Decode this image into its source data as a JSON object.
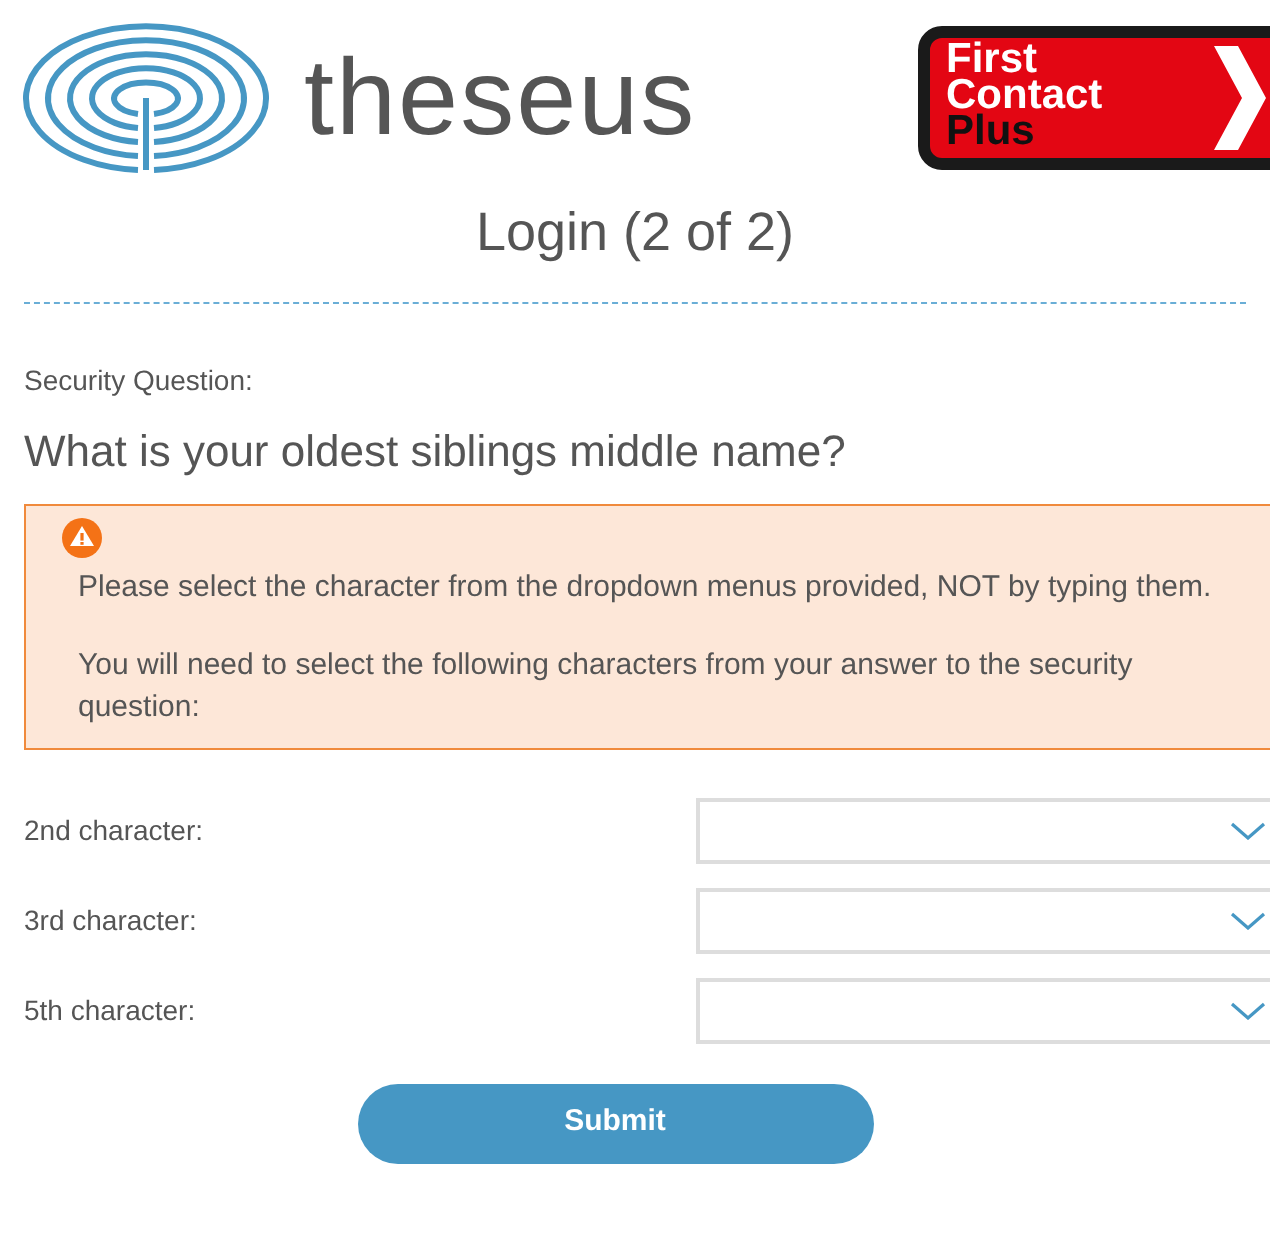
{
  "header": {
    "brand_name": "theseus",
    "partner_logo_lines": [
      "First",
      "Contact",
      "Plus"
    ]
  },
  "page_title": "Login (2 of 2)",
  "security_question": {
    "label": "Security Question:",
    "question": "What is your oldest siblings middle name?"
  },
  "alert": {
    "paragraphs": [
      "Please select the character from the dropdown menus provided, NOT by typing them.",
      "You will need to select the following characters from your answer to the security question:"
    ]
  },
  "character_fields": [
    {
      "label": "2nd character:"
    },
    {
      "label": "3rd character:"
    },
    {
      "label": "5th character:"
    }
  ],
  "submit_button": "Submit"
}
